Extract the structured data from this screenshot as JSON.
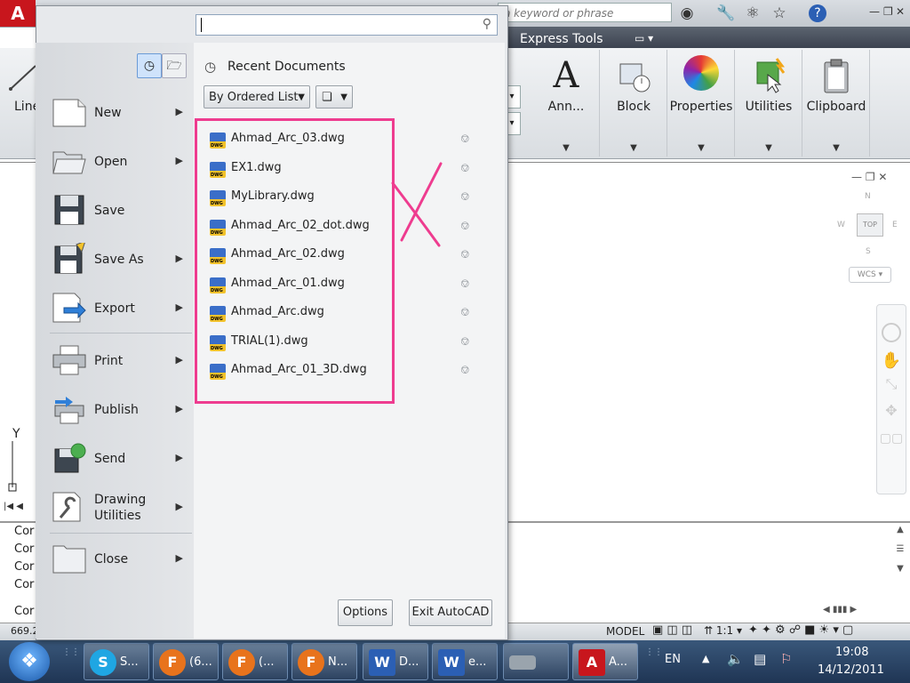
{
  "top_bar": {
    "help_search_placeholder": "a keyword or phrase"
  },
  "ribbon": {
    "tabs": [
      "Express Tools"
    ],
    "partial_left_label": "Line",
    "panels": [
      {
        "label": "Ann..."
      },
      {
        "label": "Block"
      },
      {
        "label": "Properties"
      },
      {
        "label": "Utilities"
      },
      {
        "label": "Clipboard"
      }
    ]
  },
  "viewcube": {
    "top": "TOP",
    "n": "N",
    "s": "S",
    "e": "E",
    "w": "W",
    "wcs": "WCS"
  },
  "drawing": {
    "y_axis": "Y"
  },
  "command_line": {
    "rows": [
      "Cor",
      "Cor",
      "Cor",
      "Cor",
      "Cor"
    ],
    "coord": "669.2"
  },
  "status_bar": {
    "model": "MODEL",
    "scale": "1:1"
  },
  "app_menu": {
    "left_items": [
      {
        "label": "New",
        "has_arrow": true
      },
      {
        "label": "Open",
        "has_arrow": true
      },
      {
        "label": "Save",
        "has_arrow": false
      },
      {
        "label": "Save As",
        "has_arrow": true
      },
      {
        "label": "Export",
        "has_arrow": true
      },
      {
        "label": "Print",
        "has_arrow": true
      },
      {
        "label": "Publish",
        "has_arrow": true
      },
      {
        "label": "Send",
        "has_arrow": true
      },
      {
        "label": "Drawing Utilities",
        "has_arrow": true
      },
      {
        "label": "Close",
        "has_arrow": true
      }
    ],
    "recent_title": "Recent Documents",
    "sort_dropdown": "By Ordered List",
    "recent_documents": [
      "Ahmad_Arc_03.dwg",
      "EX1.dwg",
      "MyLibrary.dwg",
      "Ahmad_Arc_02_dot.dwg",
      "Ahmad_Arc_02.dwg",
      "Ahmad_Arc_01.dwg",
      "Ahmad_Arc.dwg",
      "TRIAL(1).dwg",
      "Ahmad_Arc_01_3D.dwg"
    ],
    "options_button": "Options",
    "exit_button": "Exit AutoCAD"
  },
  "annotation": {
    "color": "#ee3c8f"
  },
  "taskbar": {
    "tasks": [
      {
        "label": "S...",
        "icon_color": "#1fa6e3",
        "icon_text": "S"
      },
      {
        "label": "(6...",
        "icon_color": "#e8731c",
        "icon_text": "F"
      },
      {
        "label": "(...",
        "icon_color": "#e8731c",
        "icon_text": "F"
      },
      {
        "label": "N...",
        "icon_color": "#e8731c",
        "icon_text": "F"
      },
      {
        "label": "D...",
        "icon_color": "#2b5fb4",
        "icon_text": "W"
      },
      {
        "label": "e...",
        "icon_color": "#2b5fb4",
        "icon_text": "W"
      },
      {
        "label": "",
        "icon_color": "#9aa4ad",
        "icon_text": ""
      },
      {
        "label": "A...",
        "icon_color": "#c8161d",
        "icon_text": "A"
      }
    ],
    "language": "EN",
    "time": "19:08",
    "date": "14/12/2011"
  },
  "colors": {
    "accent": "#1a58a8",
    "autocad_red": "#c8161d"
  }
}
